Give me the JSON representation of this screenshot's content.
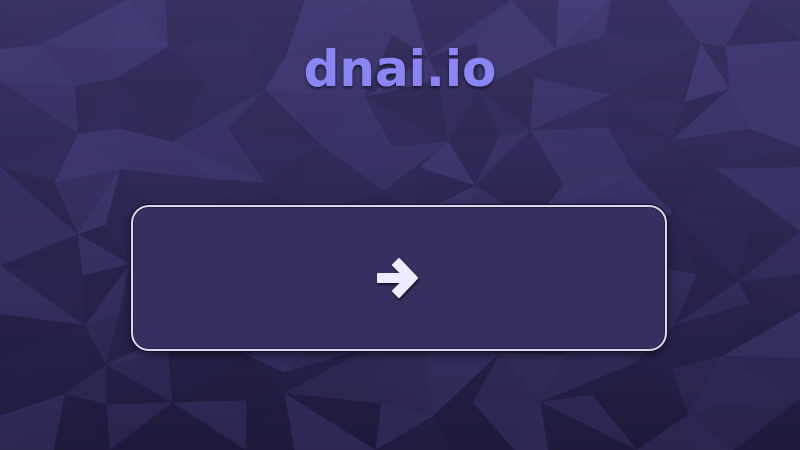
{
  "brand": {
    "logo_text": "dnai.io",
    "logo_color": "#8c86f4"
  },
  "background": {
    "color": "#2b2752",
    "pattern": "low-poly-triangles"
  },
  "action_button": {
    "icon": "arrow-right-icon",
    "border_color": "#d9d6ee",
    "fill_color": "#35305f",
    "icon_color": "#eeeaff"
  }
}
